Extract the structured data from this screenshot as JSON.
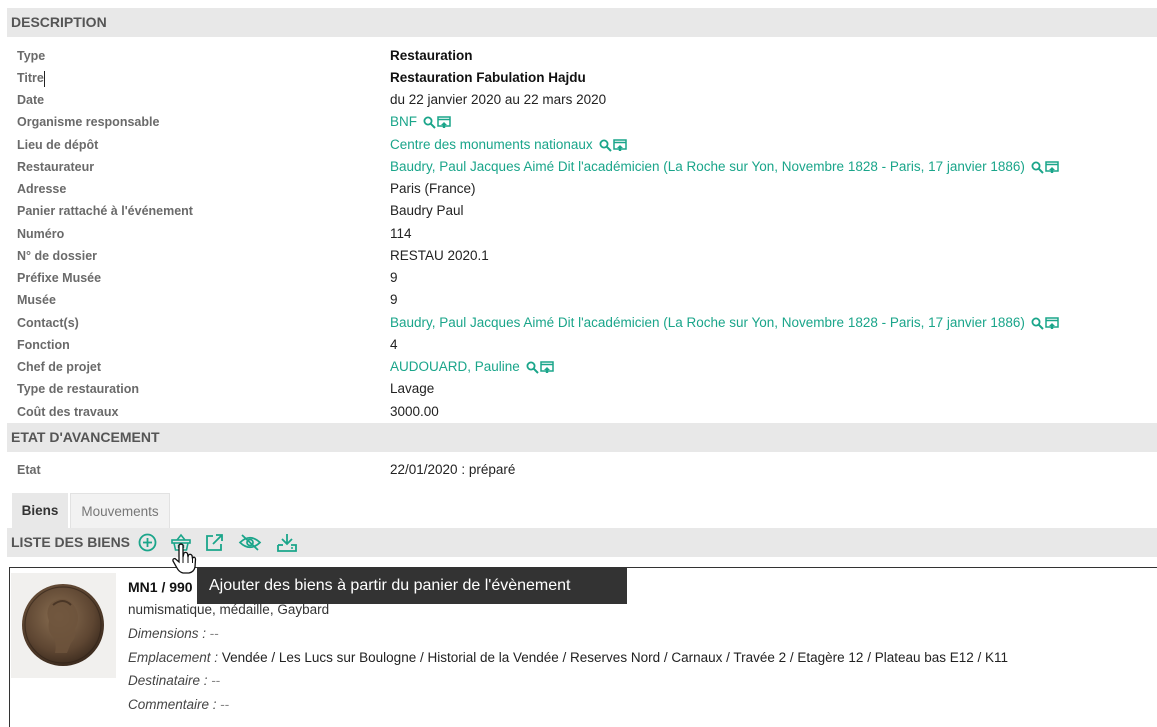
{
  "description": {
    "header": "DESCRIPTION",
    "fields": [
      {
        "label": "Type",
        "value": "Restauration"
      },
      {
        "label": "Titre",
        "value": "Restauration Fabulation Hajdu"
      },
      {
        "label": "Date",
        "value": "du 22 janvier 2020 au 22 mars 2020"
      },
      {
        "label": "Organisme responsable",
        "value": "BNF"
      },
      {
        "label": "Lieu de dépôt",
        "value": "Centre des monuments nationaux"
      },
      {
        "label": "Restaurateur",
        "value": "Baudry, Paul Jacques Aimé Dit l'académicien (La Roche sur Yon, Novembre 1828 - Paris, 17 janvier 1886)"
      },
      {
        "label": "Adresse",
        "value": "Paris (France)"
      },
      {
        "label": "Panier rattaché à l'événement",
        "value": "Baudry Paul"
      },
      {
        "label": "Numéro",
        "value": "114"
      },
      {
        "label": "N° de dossier",
        "value": "RESTAU 2020.1"
      },
      {
        "label": "Préfixe Musée",
        "value": "9"
      },
      {
        "label": "Musée",
        "value": "9"
      },
      {
        "label": "Contact(s)",
        "value": "Baudry, Paul Jacques Aimé Dit l'académicien (La Roche sur Yon, Novembre 1828 - Paris, 17 janvier 1886)"
      },
      {
        "label": "Fonction",
        "value": "4"
      },
      {
        "label": "Chef de projet",
        "value": "AUDOUARD, Pauline"
      },
      {
        "label": "Type de restauration",
        "value": "Lavage"
      },
      {
        "label": "Coût des travaux",
        "value": "3000.00"
      }
    ]
  },
  "progress": {
    "header": "ETAT D'AVANCEMENT",
    "fields": [
      {
        "label": "Etat",
        "value": "22/01/2020 : préparé"
      }
    ]
  },
  "tabs": [
    {
      "label": "Biens",
      "active": true
    },
    {
      "label": "Mouvements",
      "active": false
    }
  ],
  "list": {
    "header": "LISTE DES BIENS",
    "icons": [
      "add-circle-icon",
      "basket-icon",
      "external-link-icon",
      "eye-off-icon",
      "download-icon"
    ],
    "tooltip": "Ajouter des biens à partir du panier de l'évènement"
  },
  "item": {
    "title": "MN1 / 990",
    "category": "numismatique, médaille, Gaybard",
    "dimensions_label": "Dimensions :",
    "dimensions_value": "--",
    "location_label": "Emplacement :",
    "location_value": "Vendée / Les Lucs sur Boulogne / Historial de la Vendée / Reserves Nord / Carnaux / Travée 2 / Etagère 12 / Plateau bas E12 / K11",
    "recipient_label": "Destinataire :",
    "recipient_value": "--",
    "comment_label": "Commentaire :",
    "comment_value": "--"
  },
  "colors": {
    "accent": "#1aa58a",
    "header_bg": "#e8e8e8",
    "tooltip_bg": "#333333"
  }
}
